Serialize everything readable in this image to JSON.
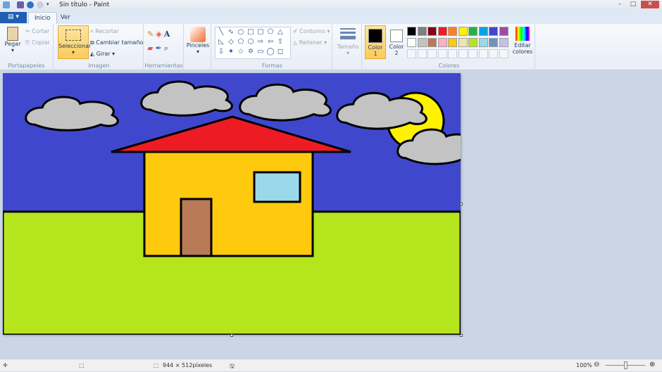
{
  "window": {
    "title": "Sin título - Paint",
    "minimize": "–",
    "maximize": "□",
    "close": "✕"
  },
  "tabs": [
    {
      "label": "Inicio",
      "active": true
    },
    {
      "label": "Ver",
      "active": false
    }
  ],
  "file_menu_icon": "file-menu-icon",
  "ribbon": {
    "portapapeles": {
      "label": "Portapapeles",
      "paste": "Pegar",
      "cut": "Cortar",
      "copy": "Copiar"
    },
    "imagen": {
      "label": "Imagen",
      "select": "Seleccionar",
      "crop": "Recortar",
      "resize": "Cambiar tamaño",
      "rotate": "Girar"
    },
    "herramientas": {
      "label": "Herramientas"
    },
    "pinceles": {
      "label": "Pinceles"
    },
    "formas": {
      "label": "Formas",
      "outline": "Contorno",
      "fill": "Rellenar",
      "shapes": [
        "╲",
        "∿",
        "○",
        "□",
        "▢",
        "⬠",
        "△",
        "◺",
        "◇",
        "⬠",
        "⬡",
        "⇨",
        "⇦",
        "⇧",
        "⇩",
        "✦",
        "☆",
        "✡",
        "▭",
        "◯",
        "◻"
      ]
    },
    "tamano": {
      "label": "Tamaño"
    },
    "colores": {
      "label": "Colores",
      "color1": "Color 1",
      "color2": "Color 2",
      "color1_value": "#000000",
      "color2_value": "#ffffff",
      "edit": "Editar colores",
      "palette": [
        "#000000",
        "#7f7f7f",
        "#880015",
        "#ed1c24",
        "#ff7f27",
        "#fff200",
        "#22b14c",
        "#00a2e8",
        "#3f48cc",
        "#a349a4",
        "#ffffff",
        "#c3c3c3",
        "#b97a57",
        "#ffaec9",
        "#ffc90e",
        "#efe4b0",
        "#b5e61d",
        "#99d9ea",
        "#7092be",
        "#c8bfe7"
      ]
    }
  },
  "drawing_colors": {
    "sky": "#3f48cc",
    "grass": "#b5e61d",
    "house": "#ffc90e",
    "roof": "#ed1c24",
    "window": "#99d9ea",
    "door": "#b97a57",
    "sun": "#fff200",
    "cloud": "#c3c3c3"
  },
  "status": {
    "dimensions": "944 × 512píxeles",
    "zoom": "100%"
  }
}
